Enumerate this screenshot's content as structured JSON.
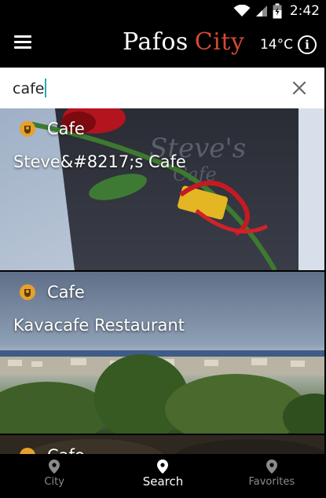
{
  "status_bar": {
    "time": "2:42"
  },
  "app_bar": {
    "brand_part1": "Pafos",
    "brand_part2": "City",
    "temperature": "14°C",
    "info_icon": "info-icon",
    "menu_icon": "hamburger-menu-icon"
  },
  "search": {
    "query": "cafe",
    "clear_icon": "close-icon"
  },
  "results": [
    {
      "category": "Cafe",
      "title": "Steve&#8217;s Cafe",
      "category_icon": "cafe-category-icon"
    },
    {
      "category": "Kavacafe Restaurant",
      "title": "Kavacafe Restaurant",
      "category_icon": "cafe-category-icon"
    },
    {
      "category": "Cafe",
      "title": "",
      "category_icon": "cafe-category-icon"
    }
  ],
  "results_fixed": [
    {
      "category": "Cafe",
      "title": "Steve&#8217;s Cafe"
    },
    {
      "category": "Cafe",
      "title": "Kavacafe Restaurant"
    },
    {
      "category": "Cafe",
      "title": ""
    }
  ],
  "bottom_nav": [
    {
      "label": "City",
      "icon": "location-pin-icon",
      "active": false
    },
    {
      "label": "Search",
      "icon": "location-pin-icon",
      "active": true
    },
    {
      "label": "Favorites",
      "icon": "location-pin-icon",
      "active": false
    }
  ],
  "colors": {
    "accent_red": "#d24a34",
    "caret": "#2aa7b8",
    "cafe_badge": "#e6a12a"
  }
}
